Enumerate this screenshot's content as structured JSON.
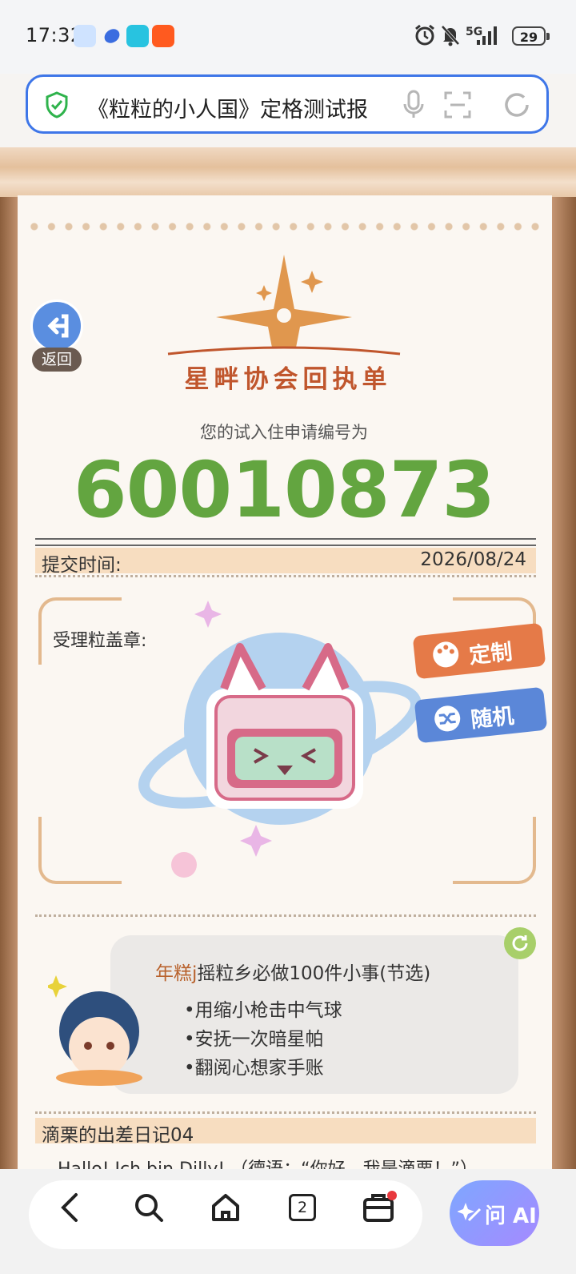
{
  "status_bar": {
    "time": "17:32",
    "network": "5G",
    "battery": "29",
    "app_icons": [
      "qq-icon",
      "feather-icon",
      "book-icon",
      "taobao-flash-icon"
    ],
    "system_icons": [
      "alarm-icon",
      "mute-icon",
      "signal-icon",
      "battery-icon"
    ]
  },
  "browser": {
    "url_title": "《粒粒的小人国》定格测试报",
    "icons": [
      "shield-check-icon",
      "microphone-icon",
      "scan-icon",
      "reload-icon"
    ]
  },
  "page": {
    "back_label": "返回",
    "org_title": "星畔协会回执单",
    "subtitle": "您的试入住申请编号为",
    "application_number": "60010873",
    "submit_label": "提交时间:",
    "submit_date": "2026/08/24",
    "seal_label": "受理粒盖章:",
    "customize_button": "定制",
    "random_button": "随机",
    "todo_owner": "年糕j",
    "todo_title_rest": "摇粒乡必做100件小事(节选)",
    "todo_items": [
      "•用缩小枪击中气球",
      "•安抚一次暗星帕",
      "•翻阅心想家手账"
    ],
    "diary_title": "滴栗的出差日记04",
    "diary_text": "Hallo! Ich bin Dilly! （德语：“你好，我是滴栗！”）"
  },
  "bottom_nav": {
    "tabs_count": "2",
    "ai_label": "问 AI",
    "icons": [
      "back-icon",
      "search-icon",
      "home-icon",
      "tabs-icon",
      "briefcase-icon",
      "sparkle-icon"
    ]
  },
  "colors": {
    "accent_blue": "#3e76e8",
    "number_green": "#63a540",
    "title_orange": "#c0562d",
    "customize_orange": "#e57a48",
    "random_blue": "#5b87d8"
  }
}
